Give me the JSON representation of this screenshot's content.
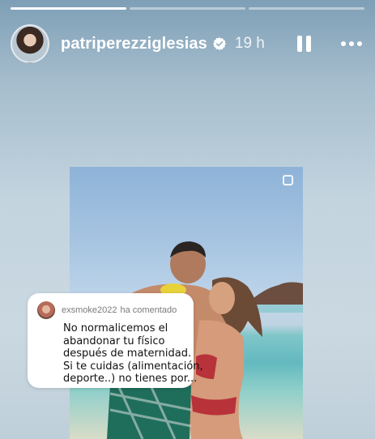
{
  "story": {
    "progress": [
      1.0,
      0.0,
      0.0
    ],
    "username": "patriperezziglesias",
    "verified_icon": "verified-badge-icon",
    "time": "19 h",
    "pause_icon": "pause-icon",
    "more_icon": "more-options-icon",
    "avatar_icon": "profile-avatar"
  },
  "comment": {
    "user": "exsmoke2022",
    "action": "ha comentado",
    "lines": [
      "No normalicemos el",
      "abandonar tu físico",
      "después de maternidad.",
      "Si te cuidas (alimentación,",
      "deporte..) no tienes por..."
    ]
  },
  "colors": {
    "background_top": "#7e9fb6",
    "background_bottom": "#bfcfd9",
    "text_primary": "#ffffff",
    "comment_bg": "#ffffff"
  }
}
